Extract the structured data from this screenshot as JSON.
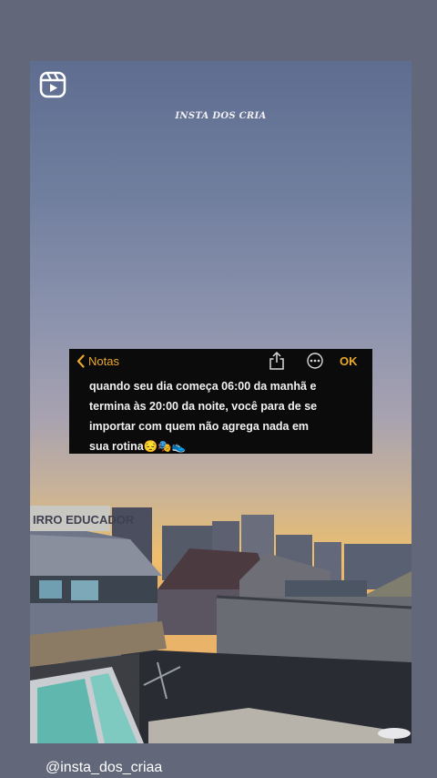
{
  "watermark": "INSTA DOS CRIA",
  "note": {
    "back_label": "Notas",
    "done_label": "OK",
    "body": "quando seu dia começa 06:00 da manhã e\ntermina às 20:00 da noite, você para de se\nimportar  com quem não agrega nada em\nsua rotina😔🎭👟"
  },
  "scene": {
    "sign_text": "IRRO EDUCADOR"
  },
  "footer": {
    "username": "@insta_dos_criaa"
  },
  "icons": {
    "reels": "reels-icon",
    "back": "chevron-left-icon",
    "share": "share-icon",
    "more": "more-circle-icon"
  },
  "colors": {
    "accent": "#e9a92a",
    "note_bg": "#0b0b0c",
    "page_bg": "#62687a"
  }
}
